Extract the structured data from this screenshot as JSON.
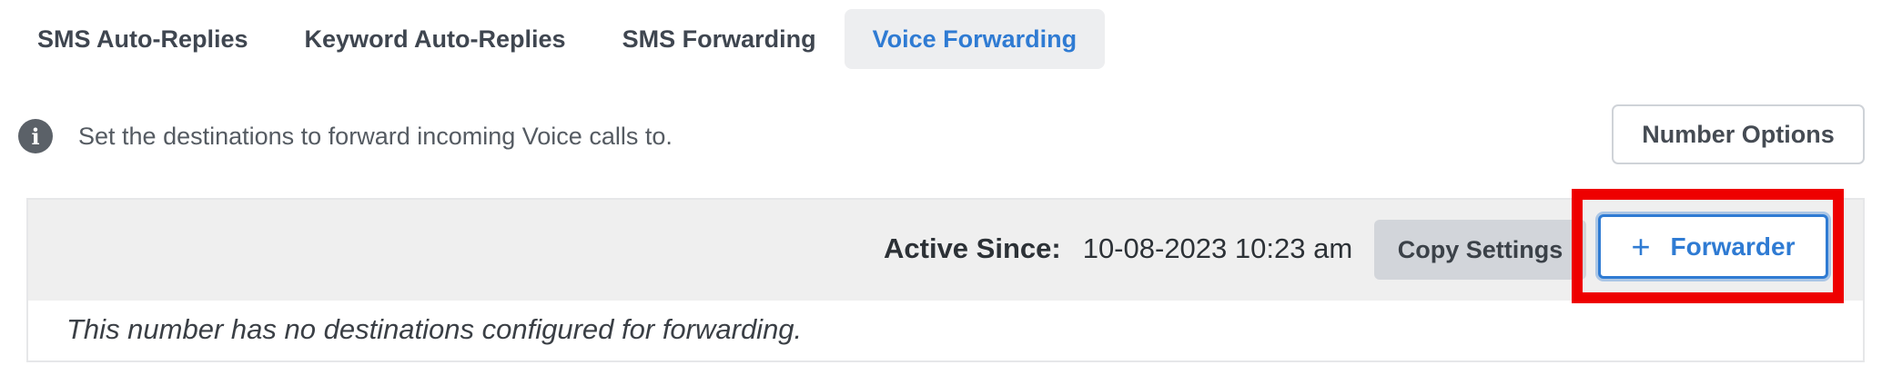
{
  "tabs": [
    {
      "label": "SMS Auto-Replies",
      "active": false
    },
    {
      "label": "Keyword Auto-Replies",
      "active": false
    },
    {
      "label": "SMS Forwarding",
      "active": false
    },
    {
      "label": "Voice Forwarding",
      "active": true
    }
  ],
  "info": {
    "icon": "info-icon",
    "icon_glyph": "i",
    "text": "Set the destinations to forward incoming Voice calls to."
  },
  "number_options": {
    "label": "Number Options"
  },
  "panel": {
    "active_since_label": "Active Since:",
    "active_since_value": "10-08-2023 10:23 am",
    "copy_settings_label": "Copy Settings",
    "forwarder_icon": "plus-icon",
    "forwarder_icon_glyph": "+",
    "forwarder_label": "Forwarder",
    "empty_message": "This number has no destinations configured for forwarding."
  },
  "colors": {
    "accent": "#2f7bd3",
    "highlight": "#ee0000",
    "header_bg": "#efefef"
  }
}
